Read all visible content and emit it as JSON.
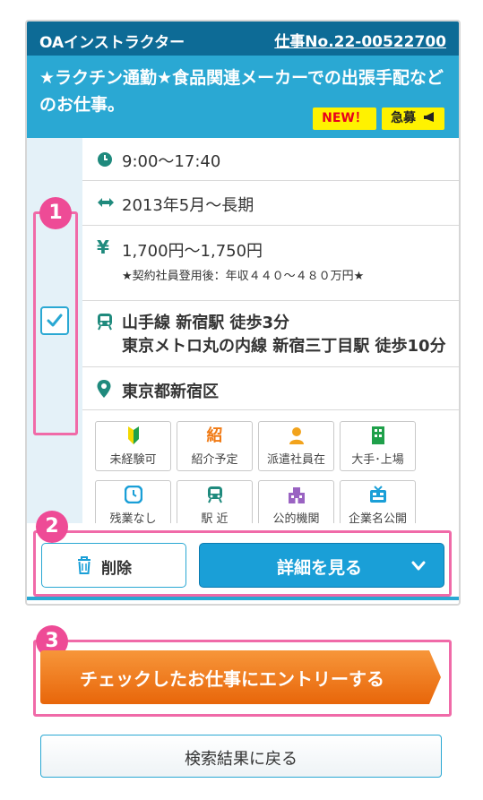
{
  "job": {
    "type": "OAインストラクター",
    "number": "仕事No.22-00522700",
    "title": "★ラクチン通勤★食品関連メーカーでの出張手配などのお仕事。",
    "badges": {
      "new": "NEW！",
      "urgent": "急募"
    },
    "hours": "9:00〜17:40",
    "period": "2013年5月〜長期",
    "wage": "1,700円〜1,750円",
    "wage_note": "★契約社員登用後：年収４４０〜４８０万円★",
    "access": [
      "山手線 新宿駅 徒歩3分",
      "東京メトロ丸の内線 新宿三丁目駅 徒歩10分"
    ],
    "location": "東京都新宿区",
    "tags": [
      "未経験可",
      "紹介予定",
      "派遣社員在",
      "大手･上場",
      "残業なし",
      "駅 近",
      "公的機関",
      "企業名公開"
    ],
    "tag_icons": [
      "beginner-mark-icon",
      "referral-icon",
      "person-icon",
      "building-icon",
      "clock-icon",
      "train-icon",
      "public-office-icon",
      "company-icon"
    ]
  },
  "actions": {
    "delete": "削除",
    "detail": "詳細を見る",
    "entry": "チェックしたお仕事にエントリーする",
    "back": "検索結果に戻る"
  },
  "callouts": [
    "1",
    "2",
    "3"
  ],
  "colors": {
    "header": "#0d6b96",
    "title_band": "#2aa8d3",
    "badge": "#fff200",
    "highlight": "#f06aa8",
    "entry": "#f07a14",
    "detail_button": "#1a9fd7"
  }
}
